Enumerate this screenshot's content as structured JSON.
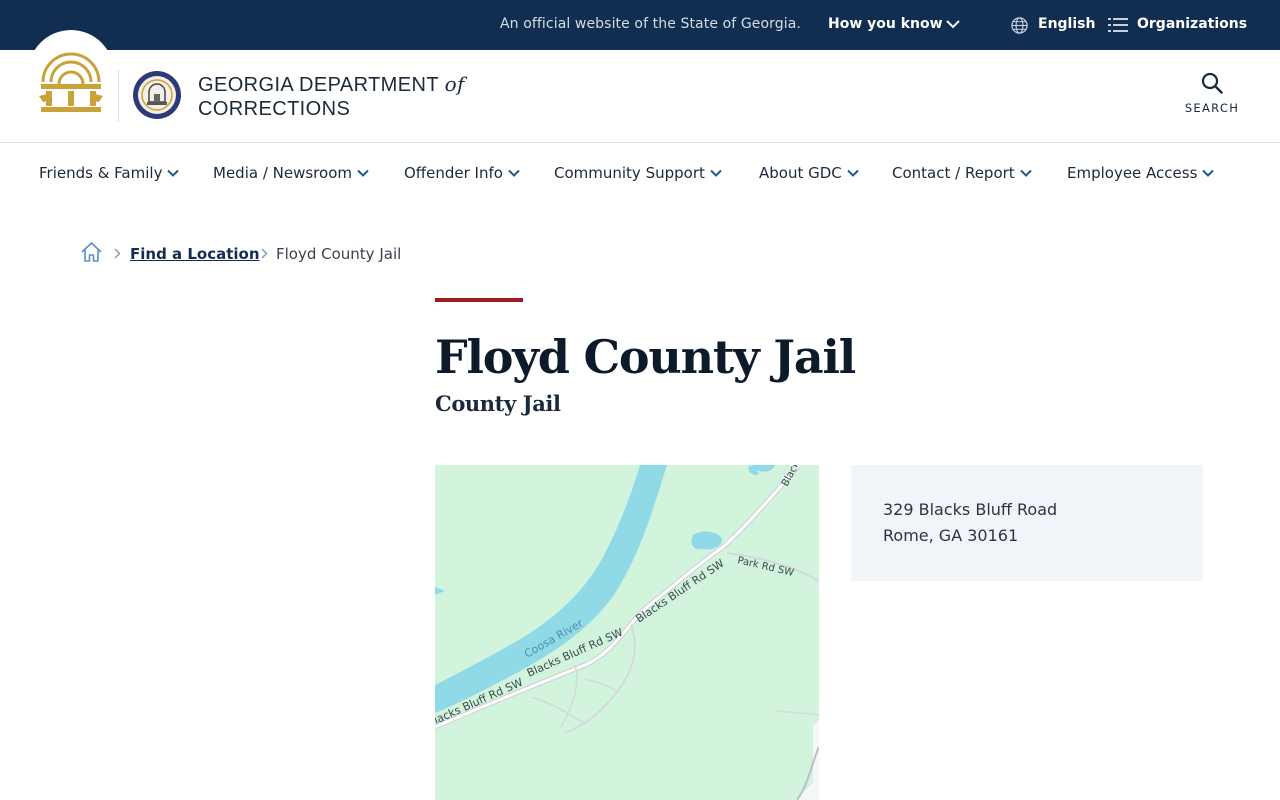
{
  "topbar": {
    "official_text": "An official website of the State of Georgia.",
    "how_you_know": "How you know",
    "language": "English",
    "organizations": "Organizations"
  },
  "header": {
    "agency_line1": "GEORGIA DEPARTMENT",
    "agency_of": "of",
    "agency_line2": "CORRECTIONS",
    "search_label": "SEARCH"
  },
  "nav": {
    "items": [
      {
        "label": "Friends & Family"
      },
      {
        "label": "Media / Newsroom"
      },
      {
        "label": "Offender Info"
      },
      {
        "label": "Community Support"
      },
      {
        "label": "About GDC"
      },
      {
        "label": "Contact / Report"
      },
      {
        "label": "Employee Access"
      }
    ]
  },
  "breadcrumb": {
    "link": "Find a Location",
    "current": "Floyd County Jail"
  },
  "page": {
    "title": "Floyd County Jail",
    "subtitle": "County Jail"
  },
  "map": {
    "river_label": "Coosa River",
    "road_labels": [
      "Blacks Bluff Rd SW",
      "Blacks Bluff Rd SW",
      "Blacks Bluff Rd SW",
      "Park Rd SW",
      "Black"
    ]
  },
  "address": {
    "street": "329 Blacks Bluff Road",
    "city_state_zip": "Rome, GA 30161"
  },
  "colors": {
    "topbar_bg": "#112e51",
    "accent_red": "#9e1b22",
    "map_land": "#d2f4dd",
    "map_water": "#90dae8",
    "seal_gold": "#c9a23a"
  },
  "icons": {
    "how_you_know": "chevron-down-icon",
    "language": "globe-icon",
    "organizations": "list-icon",
    "search": "search-icon",
    "home": "home-icon",
    "nav_dropdown": "chevron-down-icon",
    "breadcrumb_sep": "chevron-right-icon"
  }
}
